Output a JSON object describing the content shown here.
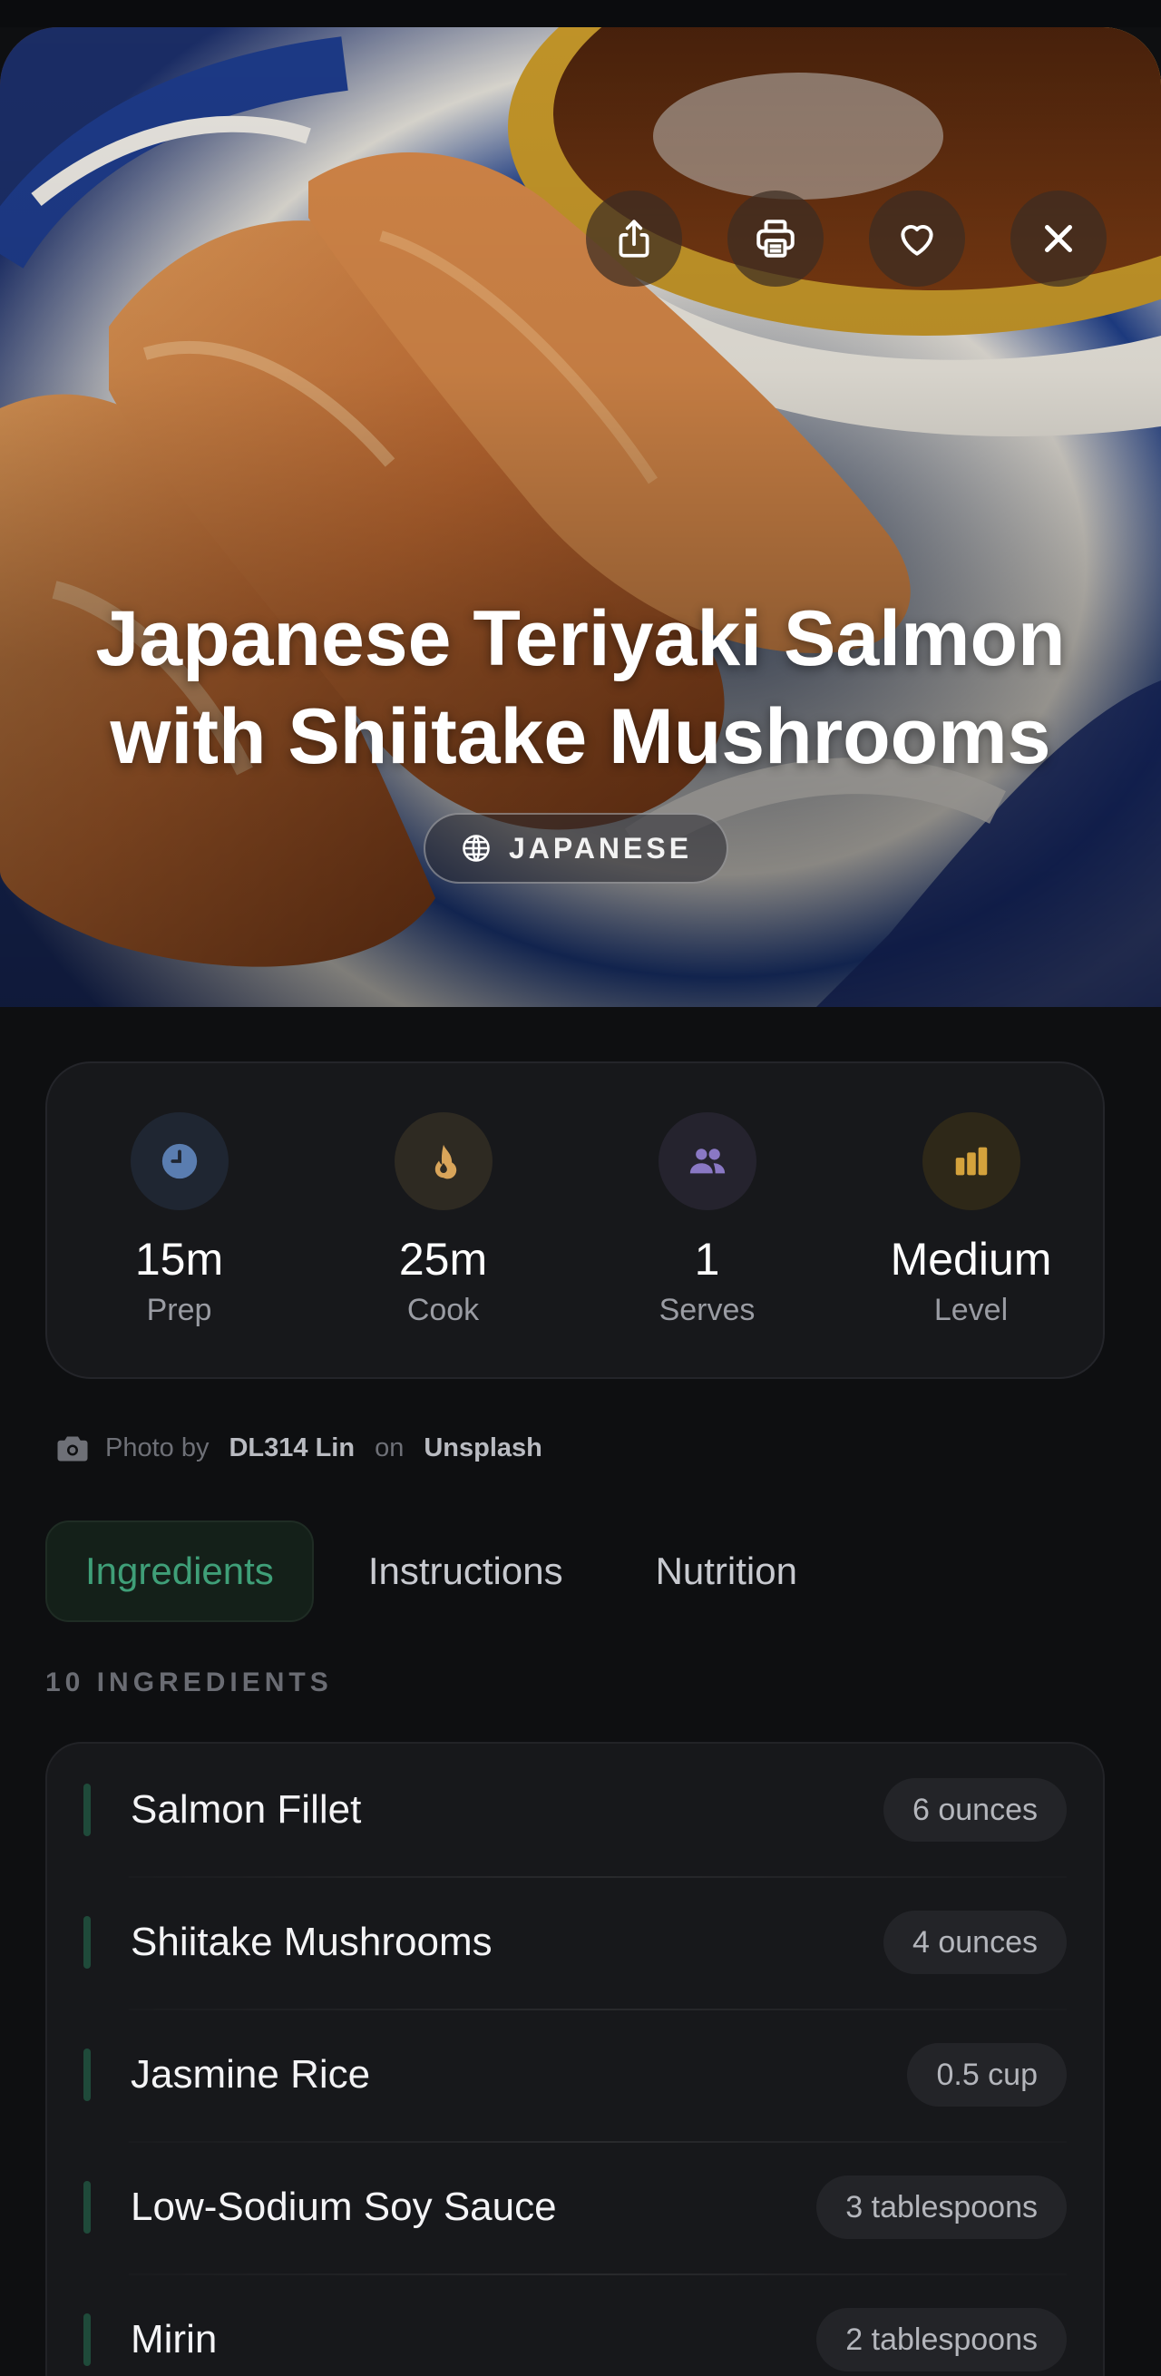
{
  "colors": {
    "accent_green": "#3f9f78",
    "stat_prep": "#5a7db0",
    "stat_cook": "#d9a55a",
    "stat_serves": "#8a78c4",
    "stat_level": "#d4a23c"
  },
  "hero": {
    "title_lines": [
      "Japanese Teriyaki Salmon",
      "with Shiitake Mushrooms"
    ],
    "cuisine": "JAPANESE",
    "actions": [
      "share-icon",
      "print-icon",
      "heart-icon",
      "close-icon"
    ]
  },
  "stats": [
    {
      "icon": "clock-icon",
      "value": "15m",
      "label": "Prep"
    },
    {
      "icon": "flame-icon",
      "value": "25m",
      "label": "Cook"
    },
    {
      "icon": "people-icon",
      "value": "1",
      "label": "Serves"
    },
    {
      "icon": "bar-chart-icon",
      "value": "Medium",
      "label": "Level"
    }
  ],
  "credit": {
    "prefix": "Photo by",
    "author": "DL314 Lin",
    "on": "on",
    "source": "Unsplash"
  },
  "tabs": [
    {
      "label": "Ingredients",
      "active": true
    },
    {
      "label": "Instructions",
      "active": false
    },
    {
      "label": "Nutrition",
      "active": false
    }
  ],
  "ingredients_count_label": "10 INGREDIENTS",
  "ingredients": [
    {
      "name": "Salmon Fillet",
      "qty": "6 ounces"
    },
    {
      "name": "Shiitake Mushrooms",
      "qty": "4 ounces"
    },
    {
      "name": "Jasmine Rice",
      "qty": "0.5 cup"
    },
    {
      "name": "Low-Sodium Soy Sauce",
      "qty": "3 tablespoons"
    },
    {
      "name": "Mirin",
      "qty": "2 tablespoons"
    }
  ]
}
